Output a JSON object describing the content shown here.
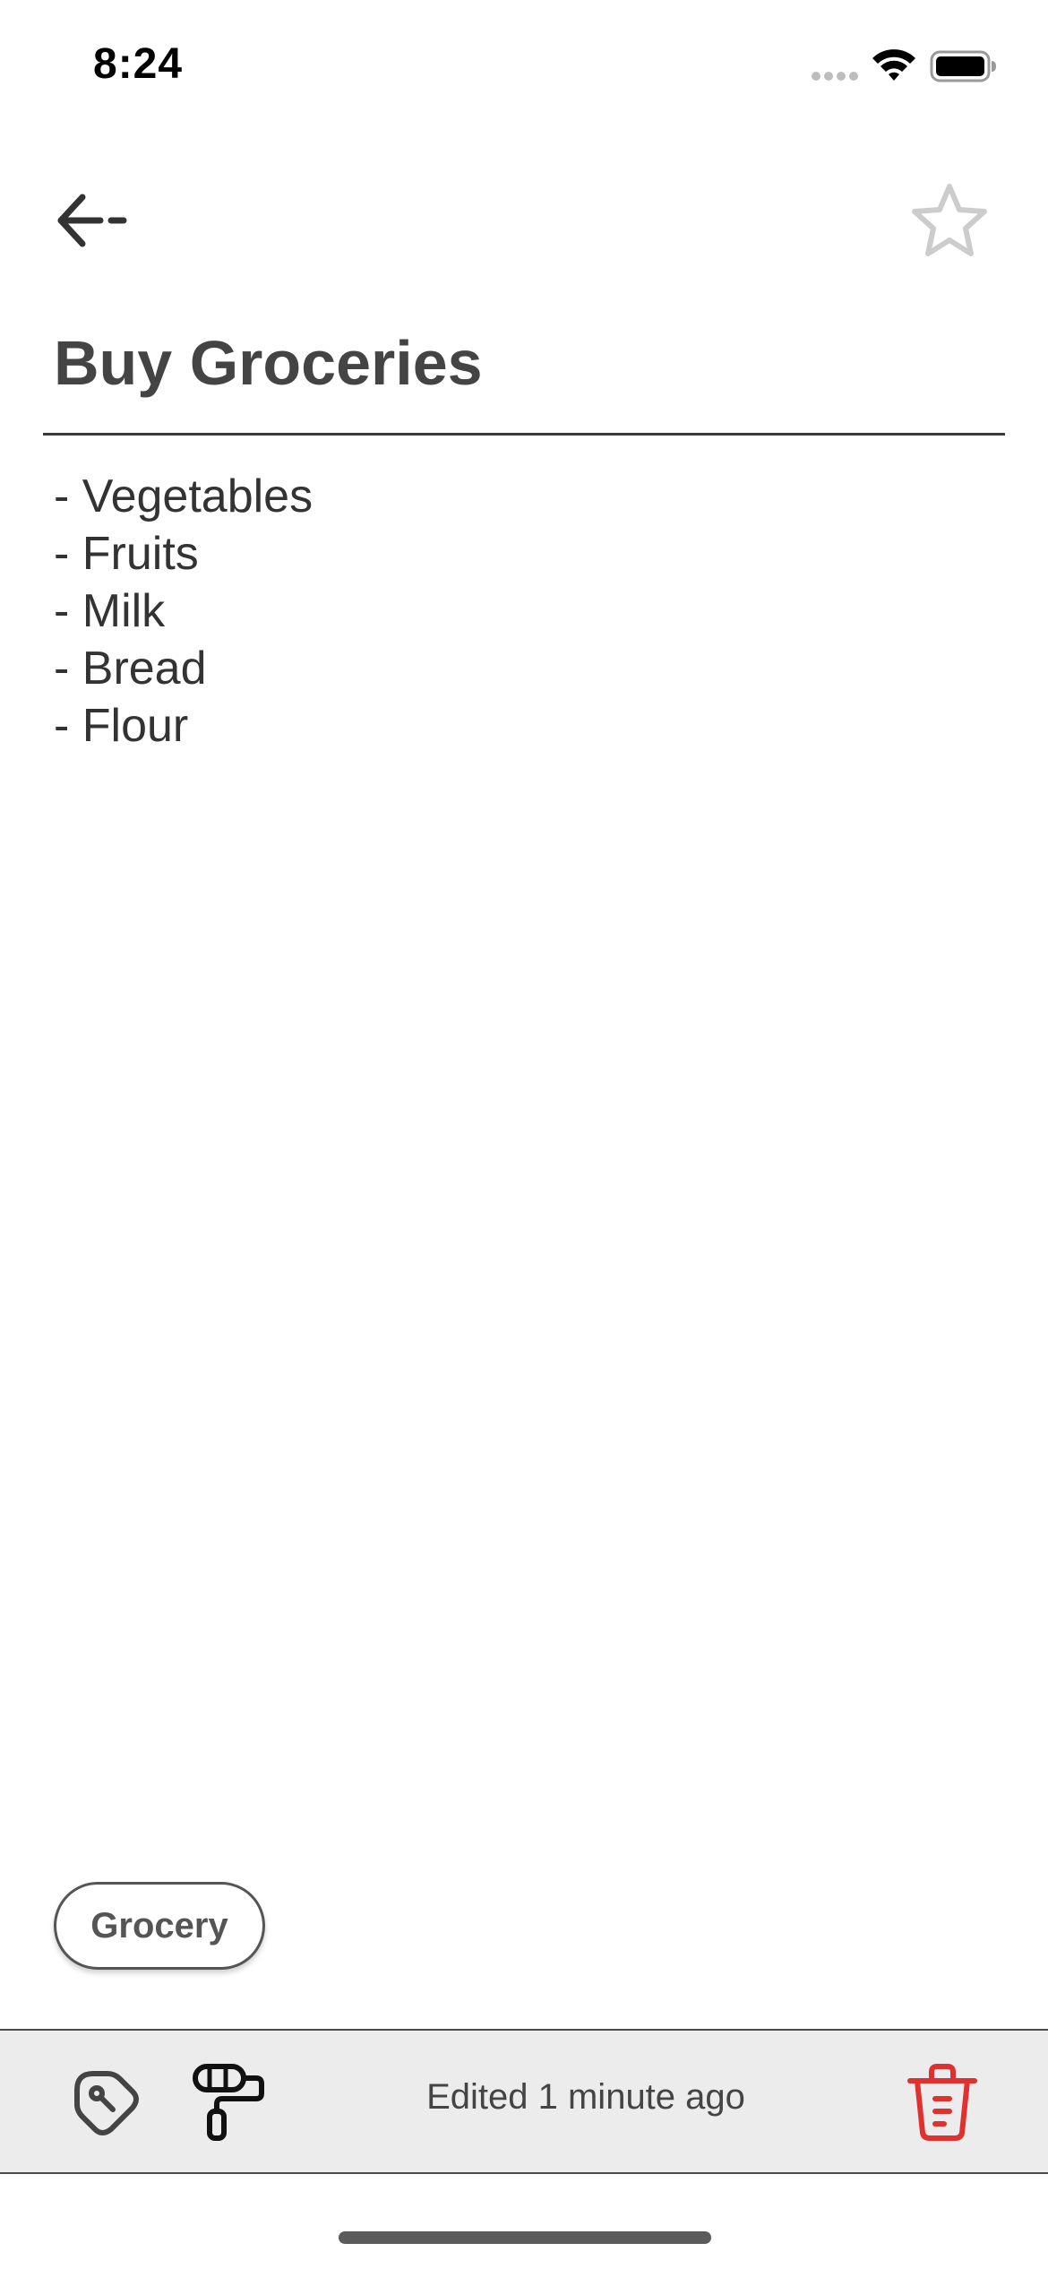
{
  "status_bar": {
    "time": "8:24"
  },
  "header": {
    "back_icon": "arrow-left-icon",
    "favorite_icon": "star-outline-icon"
  },
  "note": {
    "title": "Buy Groceries",
    "lines": [
      "- Vegetables",
      "- Fruits",
      "- Milk",
      "- Bread",
      "- Flour"
    ]
  },
  "tags": [
    "Grocery"
  ],
  "toolbar": {
    "tag_icon": "tag-icon",
    "color_icon": "paint-roller-icon",
    "edited_text": "Edited 1 minute ago",
    "delete_icon": "trash-icon"
  },
  "colors": {
    "text": "#444444",
    "toolbar_background": "#ececec",
    "delete_accent": "#e03131",
    "star_outline": "#cccccc"
  }
}
